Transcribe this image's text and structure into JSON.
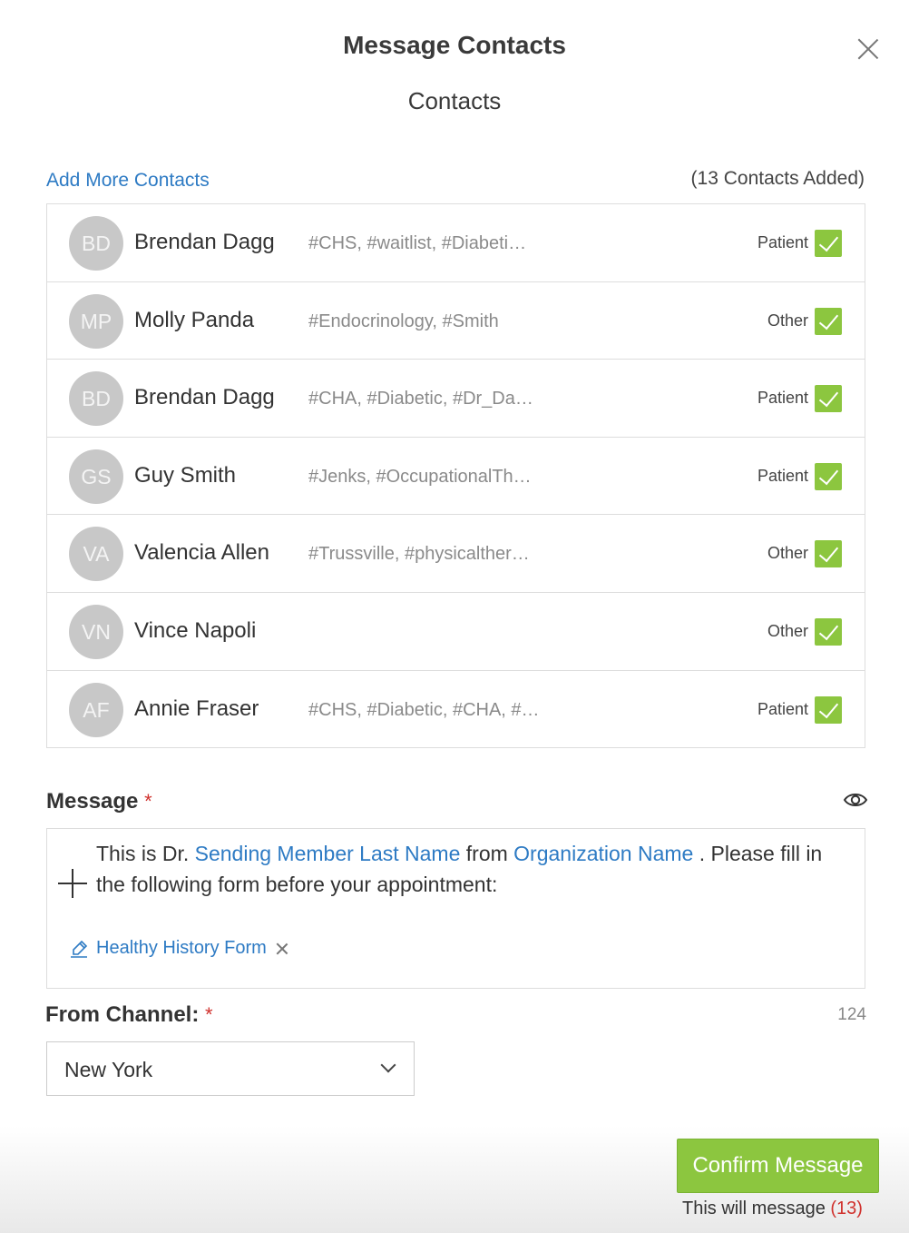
{
  "modal": {
    "title": "Message Contacts",
    "subtitle": "Contacts",
    "close_icon": "close-icon"
  },
  "contacts_header": {
    "add_more_label": "Add More Contacts",
    "count_label": "(13 Contacts Added)"
  },
  "contacts": [
    {
      "initials": "BD",
      "name": "Brendan Dagg",
      "tags": "#CHS, #waitlist, #Diabeti…",
      "type": "Patient",
      "checked": true
    },
    {
      "initials": "MP",
      "name": "Molly Panda",
      "tags": "#Endocrinology, #Smith",
      "type": "Other",
      "checked": true
    },
    {
      "initials": "BD",
      "name": "Brendan Dagg",
      "tags": "#CHA, #Diabetic, #Dr_Da…",
      "type": "Patient",
      "checked": true
    },
    {
      "initials": "GS",
      "name": "Guy Smith",
      "tags": "#Jenks, #OccupationalTh…",
      "type": "Patient",
      "checked": true
    },
    {
      "initials": "VA",
      "name": "Valencia Allen",
      "tags": "#Trussville, #physicalther…",
      "type": "Other",
      "checked": true
    },
    {
      "initials": "VN",
      "name": "Vince Napoli",
      "tags": "",
      "type": "Other",
      "checked": true
    },
    {
      "initials": "AF",
      "name": "Annie Fraser",
      "tags": "#CHS, #Diabetic, #CHA, #…",
      "type": "Patient",
      "checked": true
    }
  ],
  "message": {
    "label": "Message",
    "required_mark": "*",
    "text_part1": "This is Dr.",
    "token1": "Sending Member Last Name",
    "text_part2": "from",
    "token2": "Organization Name",
    "text_part3": ". Please fill in the following form before your appointment:",
    "attachment_label": "Healthy History Form"
  },
  "channel": {
    "label": "From Channel:",
    "required_mark": "*",
    "char_count": "124",
    "selected": "New York"
  },
  "footer": {
    "confirm_label": "Confirm Message",
    "will_message_prefix": "This will message",
    "will_message_count": "(13)"
  },
  "colors": {
    "accent_link": "#2e7bc4",
    "check_green": "#8cc63f",
    "required_red": "#d0312d"
  }
}
